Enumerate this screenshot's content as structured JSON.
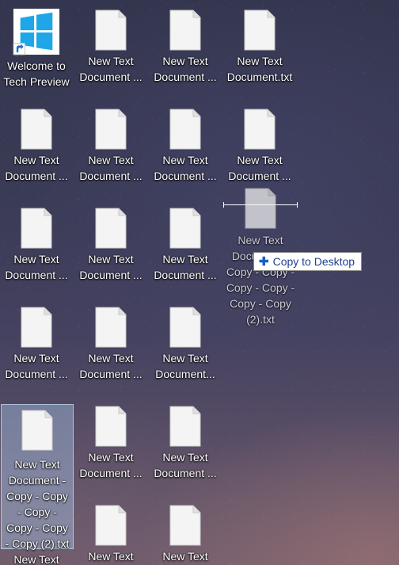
{
  "desktop": {
    "icons": [
      {
        "label": "Welcome to Tech Preview",
        "type": "windows-shortcut"
      },
      {
        "label": "New Text Document ...",
        "type": "text-file"
      },
      {
        "label": "New Text Document ...",
        "type": "text-file"
      },
      {
        "label": "New Text Document.txt",
        "type": "text-file"
      },
      {
        "label": "New Text Document ...",
        "type": "text-file"
      },
      {
        "label": "New Text Document ...",
        "type": "text-file"
      },
      {
        "label": "New Text Document ...",
        "type": "text-file"
      },
      {
        "label": "New Text Document ...",
        "type": "text-file"
      },
      {
        "label": "New Text Document ...",
        "type": "text-file"
      },
      {
        "label": "New Text Document ...",
        "type": "text-file"
      },
      {
        "label": "New Text Document ...",
        "type": "text-file"
      },
      {
        "label": "New Text Document ...",
        "type": "text-file"
      },
      {
        "label": "New Text Document ...",
        "type": "text-file"
      },
      {
        "label": "New Text Document...",
        "type": "text-file"
      },
      {
        "label": "New Text Document - Copy - Copy - Copy - Copy - Copy - Copy (2).txt",
        "type": "text-file",
        "selected": true
      },
      {
        "label": "New Text Document ...",
        "type": "text-file"
      },
      {
        "label": "New Text Document ...",
        "type": "text-file"
      },
      {
        "label": "New Text",
        "type": "text-file"
      },
      {
        "label": "New Text",
        "type": "text-file"
      },
      {
        "label": "New Text",
        "type": "text-file"
      }
    ]
  },
  "drag": {
    "ghost_label": "New Text Document - Copy - Copy - Copy - Copy - Copy - Copy (2).txt",
    "tooltip_label": "Copy to Desktop",
    "tooltip_icon": "plus-icon"
  },
  "colors": {
    "windows_logo": "#1fa6e8",
    "selection_fill": "#aac8eb",
    "tooltip_text": "#1f3f8f"
  }
}
